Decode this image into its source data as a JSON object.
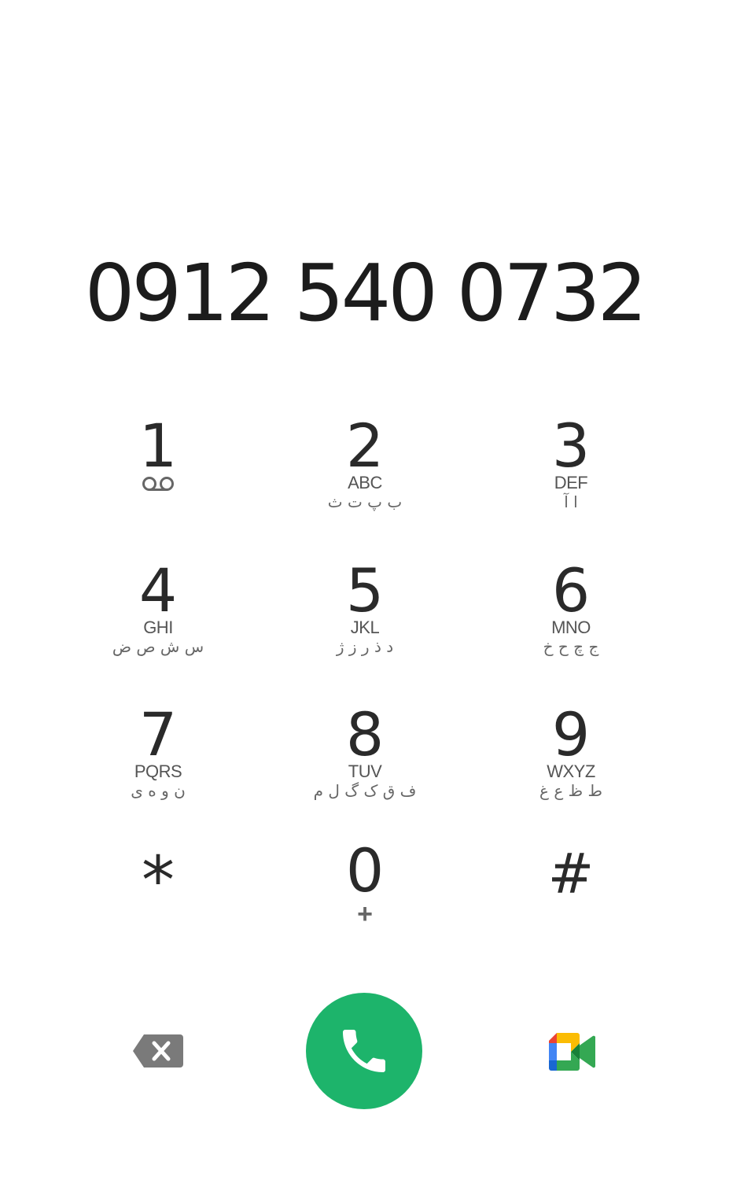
{
  "dialer": {
    "number": "0912 540 0732"
  },
  "keypad": {
    "keys": [
      {
        "digit": "1",
        "latin": "",
        "arabic": ""
      },
      {
        "digit": "2",
        "latin": "ABC",
        "arabic": "ب پ ت ث"
      },
      {
        "digit": "3",
        "latin": "DEF",
        "arabic": "ا آ"
      },
      {
        "digit": "4",
        "latin": "GHI",
        "arabic": "س ش ص ض"
      },
      {
        "digit": "5",
        "latin": "JKL",
        "arabic": "د ذ ر ز ژ"
      },
      {
        "digit": "6",
        "latin": "MNO",
        "arabic": "ج چ ح خ"
      },
      {
        "digit": "7",
        "latin": "PQRS",
        "arabic": "ن و ه ی"
      },
      {
        "digit": "8",
        "latin": "TUV",
        "arabic": "ف ق ک گ ل م"
      },
      {
        "digit": "9",
        "latin": "WXYZ",
        "arabic": "ط ظ ع غ"
      },
      {
        "digit": "*",
        "latin": "",
        "arabic": ""
      },
      {
        "digit": "0",
        "latin": "+",
        "arabic": ""
      },
      {
        "digit": "#",
        "latin": "",
        "arabic": ""
      }
    ]
  },
  "icons": {
    "voicemail": "voicemail-icon",
    "backspace": "backspace-icon",
    "call": "phone-icon",
    "video": "google-meet-icon"
  },
  "colors": {
    "call_green": "#1db46b",
    "backspace_gray": "#7a7a7a"
  }
}
